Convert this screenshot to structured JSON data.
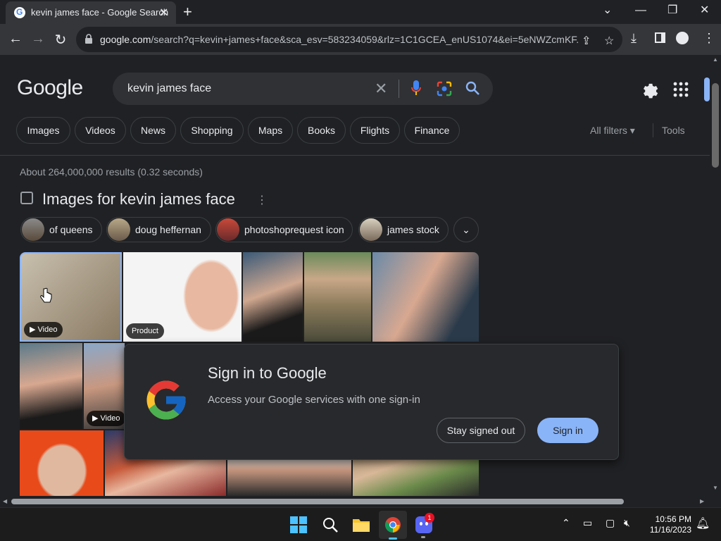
{
  "browser": {
    "tab_title": "kevin james face - Google Search",
    "url_domain": "google.com",
    "url_rest": "/search?q=kevin+james+face&sca_esv=583234059&rlz=1C1GCEA_enUS1074&ei=5eNWZcmKF...",
    "favicon_letter": "G"
  },
  "search": {
    "logo": "Google",
    "query": "kevin james face"
  },
  "nav_chips": [
    {
      "label": "Images"
    },
    {
      "label": "Videos"
    },
    {
      "label": "News"
    },
    {
      "label": "Shopping"
    },
    {
      "label": "Maps"
    },
    {
      "label": "Books"
    },
    {
      "label": "Flights"
    },
    {
      "label": "Finance"
    }
  ],
  "filters": {
    "all_filters": "All filters ▾",
    "tools": "Tools"
  },
  "results": {
    "stats": "About 264,000,000 results (0.32 seconds)",
    "images_title": "Images for kevin james face"
  },
  "related_chips": [
    {
      "label": "of queens"
    },
    {
      "label": "doug heffernan"
    },
    {
      "label": "photoshoprequest icon"
    },
    {
      "label": "james stock"
    }
  ],
  "image_badges": {
    "video_1": "▶ Video",
    "product": "Product",
    "video_2": "▶ Video"
  },
  "dialog": {
    "heading": "Sign in to Google",
    "body": "Access your Google services with one sign-in",
    "stay_signed_out": "Stay signed out",
    "sign_in": "Sign in"
  },
  "taskbar": {
    "time": "10:56 PM",
    "date": "11/16/2023",
    "discord_badge": "1"
  },
  "colors": {
    "background": "#202124",
    "accent": "#8ab4f8"
  }
}
